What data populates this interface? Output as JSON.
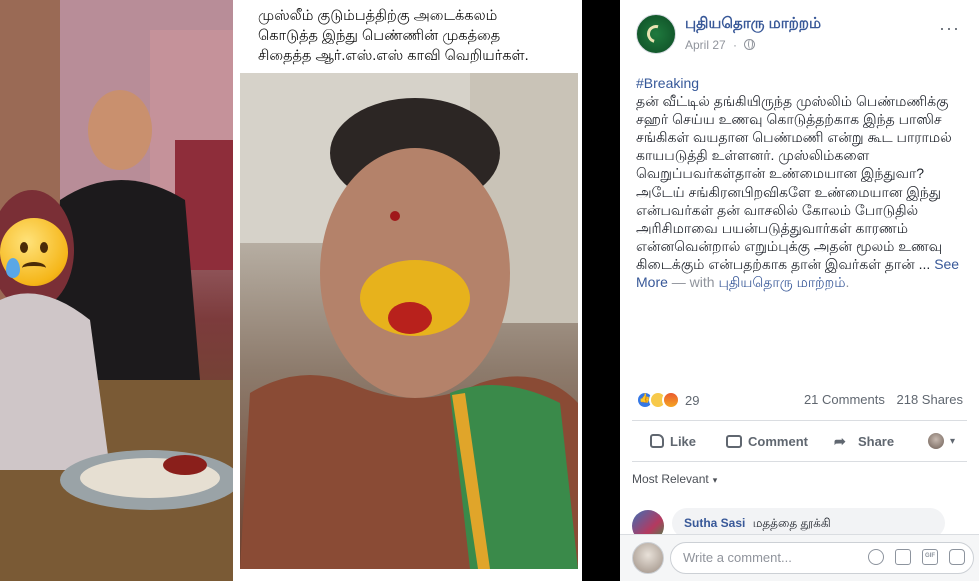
{
  "image": {
    "caption_lines": [
      "முஸ்லீம் குடும்பத்திற்கு அடைக்கலம்",
      "கொடுத்த இந்து பெண்ணின் முகத்தை",
      "சிதைத்த ஆர்.எஸ்.எஸ் காவி வெறியர்கள்."
    ]
  },
  "post": {
    "page_name": "புதியதொரு மாற்றம்",
    "date": "April 27",
    "separator": "·",
    "more": "···",
    "hashtag": "#Breaking",
    "body": "தன் வீட்டில் தங்கியிருந்த முஸ்லிம் பெண்மணிக்கு சஹர் செய்ய உணவு கொடுத்தற்காக இந்த பாஸிச சங்கிகள் வயதான பெண்மணி என்று கூட பாராமல் காயபடுத்தி உள்ளனர். முஸ்லிம்களை வெறுப்பவர்கள்தான் உண்மையான இந்துவா? அடேய் சங்கிரனபிறவிகளே உண்மையான இந்து என்பவர்கள் தன் வாசலில் கோலம் போடுதில் அரிசிமாவை பயன்படுத்துவார்கள் காரணம் என்னவென்றால் எறும்புக்கு அதன் மூலம் உணவு கிடைக்கும் என்பதற்காக தான் இவர்கள் தான் ...",
    "see_more": "See More",
    "with_text": " — with",
    "with_page": "புதியதொரு மாற்றம்",
    "with_end": "."
  },
  "stats": {
    "reaction_count": "29",
    "comments": "21 Comments",
    "shares": "218 Shares"
  },
  "actions": {
    "like": "Like",
    "comment": "Comment",
    "share": "Share",
    "caret": "▾"
  },
  "filter": {
    "label": "Most Relevant",
    "caret": "▾"
  },
  "comments": [
    {
      "author": "Sutha Sasi",
      "text": "மதத்தை தூக்கி"
    }
  ],
  "compose": {
    "placeholder": "Write a comment...",
    "gif": "GIF"
  },
  "colors": {
    "link": "#385898",
    "muted": "#90949c",
    "like_blue": "#3578e5"
  }
}
